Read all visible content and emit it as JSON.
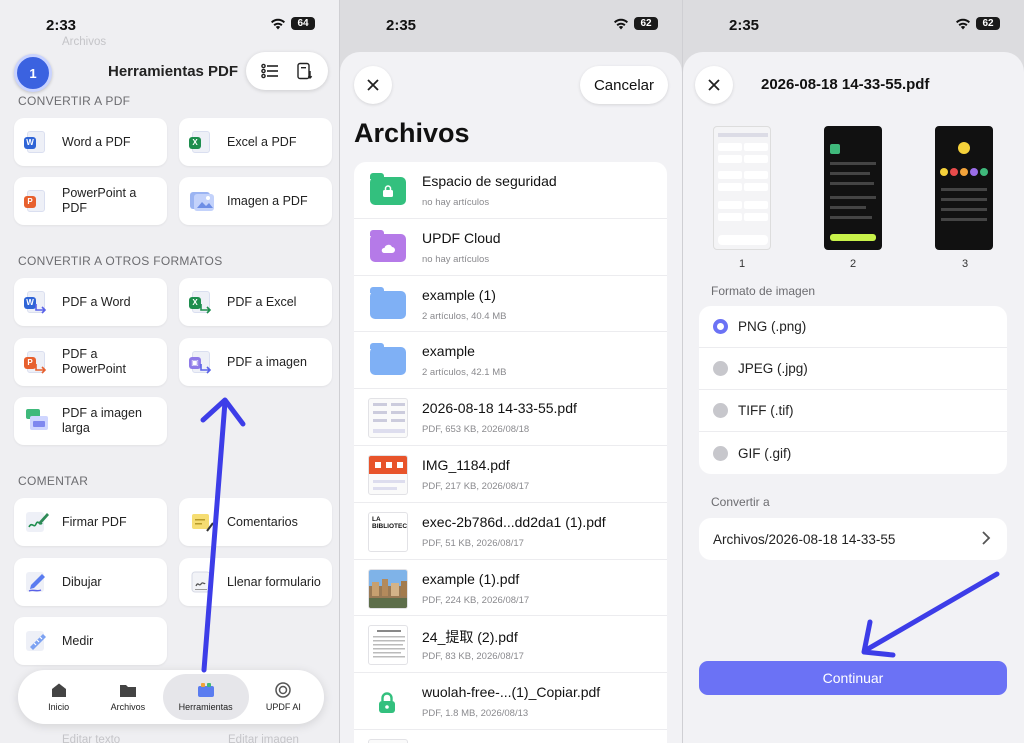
{
  "status_bars": [
    {
      "time": "2:33",
      "battery": "64"
    },
    {
      "time": "2:35",
      "battery": "62"
    },
    {
      "time": "2:35",
      "battery": "62"
    }
  ],
  "tools_panel": {
    "avatar_text": "1",
    "title": "Herramientas PDF",
    "sections": {
      "convert_to_pdf": "CONVERTIR A PDF",
      "convert_other": "CONVERTIR A OTROS FORMATOS",
      "comment": "COMENTAR"
    },
    "tiles": {
      "word_to_pdf": "Word a PDF",
      "excel_to_pdf": "Excel a PDF",
      "ppt_to_pdf": "PowerPoint a PDF",
      "image_to_pdf": "Imagen a PDF",
      "pdf_to_word": "PDF a Word",
      "pdf_to_excel": "PDF a Excel",
      "pdf_to_ppt": "PDF a PowerPoint",
      "pdf_to_image": "PDF a imagen",
      "pdf_to_long_image": "PDF a imagen larga",
      "sign_pdf": "Firmar PDF",
      "comments": "Comentarios",
      "draw": "Dibujar",
      "fill_form": "Llenar formulario",
      "measure": "Medir"
    },
    "faded": {
      "top_left": "Archivos",
      "bottom_left": "Editar texto",
      "bottom_right": "Editar imagen"
    },
    "tabbar": [
      {
        "label": "Inicio"
      },
      {
        "label": "Archivos"
      },
      {
        "label": "Herramientas"
      },
      {
        "label": "UPDF AI"
      }
    ]
  },
  "files_panel": {
    "cancel": "Cancelar",
    "title": "Archivos",
    "rows": [
      {
        "name": "Espacio de seguridad",
        "meta": "no hay artículos"
      },
      {
        "name": "UPDF Cloud",
        "meta": "no hay artículos"
      },
      {
        "name": "example (1)",
        "meta": "2 artículos, 40.4 MB"
      },
      {
        "name": "example",
        "meta": "2 artículos, 42.1 MB"
      },
      {
        "name": "2026-08-18 14-33-55.pdf",
        "meta": "PDF, 653 KB, 2026/08/18"
      },
      {
        "name": "IMG_1184.pdf",
        "meta": "PDF, 217 KB, 2026/08/17"
      },
      {
        "name": "exec-2b786d...dd2da1 (1).pdf",
        "meta": "PDF, 51 KB, 2026/08/17"
      },
      {
        "name": "example (1).pdf",
        "meta": "PDF, 224 KB, 2026/08/17"
      },
      {
        "name": "24_提取 (2).pdf",
        "meta": "PDF, 83 KB, 2026/08/17"
      },
      {
        "name": "wuolah-free-...(1)_Copiar.pdf",
        "meta": "PDF, 1.8 MB, 2026/08/13"
      }
    ],
    "thumb_text": "LA BIBLIOTECA"
  },
  "export_panel": {
    "title": "2026-08-18 14-33-55.pdf",
    "pages": [
      "1",
      "2",
      "3"
    ],
    "format_label": "Formato de imagen",
    "formats": [
      {
        "label": "PNG (.png)",
        "selected": true
      },
      {
        "label": "JPEG (.jpg)",
        "selected": false
      },
      {
        "label": "TIFF (.tif)",
        "selected": false
      },
      {
        "label": "GIF (.gif)",
        "selected": false
      }
    ],
    "convert_to_label": "Convertir a",
    "destination": "Archivos/2026-08-18 14-33-55",
    "continue": "Continuar"
  },
  "colors": {
    "accent": "#6b72f5",
    "annotation_arrow": "#3d3de8"
  }
}
